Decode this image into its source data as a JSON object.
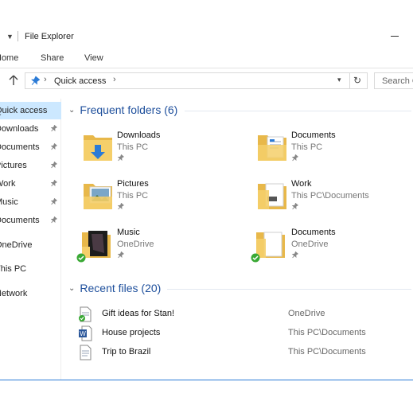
{
  "window": {
    "title": "File Explorer"
  },
  "ribbon": {
    "tabs": [
      "Home",
      "Share",
      "View"
    ]
  },
  "address": {
    "crumb": "Quick access",
    "search_placeholder": "Search Quick access"
  },
  "nav": {
    "items": [
      {
        "label": "Quick access",
        "pinned": false,
        "selected": true
      },
      {
        "label": "Downloads",
        "pinned": true
      },
      {
        "label": "Documents",
        "pinned": true
      },
      {
        "label": "Pictures",
        "pinned": true
      },
      {
        "label": "Work",
        "pinned": true
      },
      {
        "label": "Music",
        "pinned": true
      },
      {
        "label": "Documents",
        "pinned": true
      },
      {
        "label": "OneDrive",
        "pinned": false
      },
      {
        "label": "This PC",
        "pinned": false
      },
      {
        "label": "Network",
        "pinned": false
      }
    ]
  },
  "frequent": {
    "header": "Frequent folders (6)",
    "folders": [
      {
        "name": "Downloads",
        "location": "This PC",
        "icon": "downloads-folder-icon"
      },
      {
        "name": "Documents",
        "location": "This PC",
        "icon": "documents-folder-icon"
      },
      {
        "name": "Pictures",
        "location": "This PC",
        "icon": "pictures-folder-icon"
      },
      {
        "name": "Work",
        "location": "This PC\\Documents",
        "icon": "work-folder-icon"
      },
      {
        "name": "Music",
        "location": "OneDrive",
        "icon": "music-folder-icon",
        "synced": true
      },
      {
        "name": "Documents",
        "location": "OneDrive",
        "icon": "documents-folder-icon",
        "synced": true
      }
    ]
  },
  "recent": {
    "header": "Recent files (20)",
    "files": [
      {
        "name": "Gift ideas for Stan!",
        "location": "OneDrive",
        "icon": "onedrive-file-icon"
      },
      {
        "name": "House projects",
        "location": "This PC\\Documents",
        "icon": "word-file-icon"
      },
      {
        "name": "Trip to Brazil",
        "location": "This PC\\Documents",
        "icon": "document-file-icon"
      }
    ]
  },
  "colors": {
    "accent": "#1e4f9c",
    "selection": "#cce8ff",
    "folder": "#f5cf6a",
    "pin_blue": "#2b7bd6"
  }
}
